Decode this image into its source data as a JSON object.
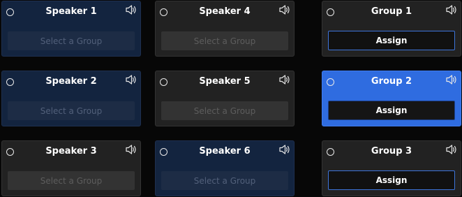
{
  "speakers": [
    {
      "title": "Speaker 1",
      "placeholder": "Select a Group"
    },
    {
      "title": "Speaker 2",
      "placeholder": "Select a Group"
    },
    {
      "title": "Speaker 3",
      "placeholder": "Select a Group"
    },
    {
      "title": "Speaker 4",
      "placeholder": "Select a Group"
    },
    {
      "title": "Speaker 5",
      "placeholder": "Select a Group"
    },
    {
      "title": "Speaker 6",
      "placeholder": "Select a Group"
    }
  ],
  "groups": [
    {
      "title": "Group 1",
      "button": "Assign"
    },
    {
      "title": "Group 2",
      "button": "Assign"
    },
    {
      "title": "Group 3",
      "button": "Assign"
    }
  ],
  "icons": {
    "radio": "radio-button-icon",
    "volume": "speaker-volume-icon"
  },
  "colors": {
    "background": "#070707",
    "card": "#222222",
    "card_blue": "#13243f",
    "selected": "#2f6ce0",
    "accent_border": "#3d74da"
  }
}
